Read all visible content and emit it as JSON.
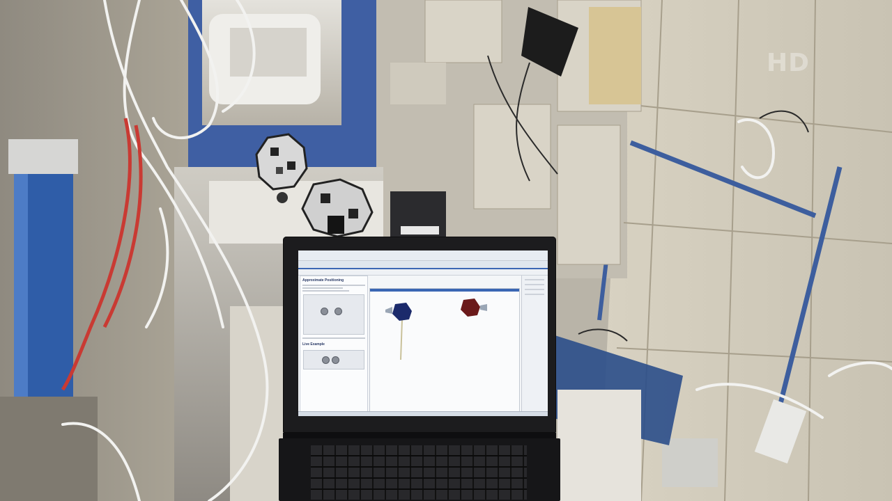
{
  "scene": {
    "description_label": "",
    "watermark_text": "HD"
  },
  "laptop": {
    "left_pane_heading": "Approximate Positioning",
    "left_pane_subheading": "Live Example",
    "colors": {
      "screen_bg": "#f4f6f8",
      "accent_blue": "#3a66b4",
      "satellite_blue": "#1b2a6b",
      "satellite_red": "#6b1a1a"
    }
  },
  "icons": [
    "satellite-blue-icon",
    "satellite-red-icon",
    "trajectory-line"
  ]
}
